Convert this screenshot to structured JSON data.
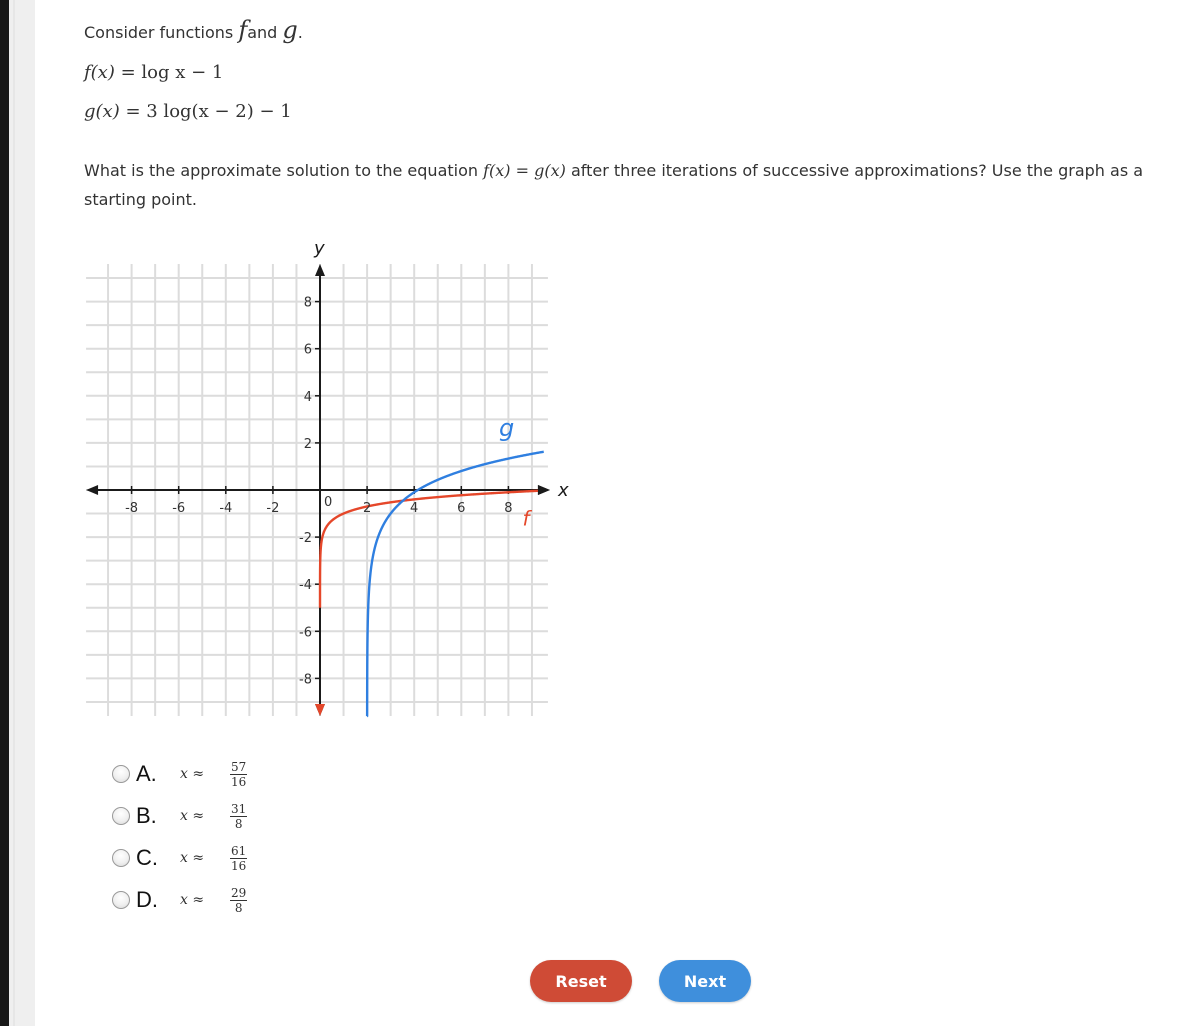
{
  "intro": {
    "prefix": "Consider functions ",
    "f": "f",
    "and": "and ",
    "g": "g",
    "suffix": "."
  },
  "equations": {
    "f": {
      "lhs": "f(x)",
      "rhs": "= log x − 1"
    },
    "g": {
      "lhs": "g(x)",
      "rhs": "= 3 log(x − 2) − 1"
    }
  },
  "question": {
    "before": "What is the approximate solution to the equation ",
    "math": "f(x) = g(x)",
    "after": " after three iterations of successive approximations? Use the graph as a starting point."
  },
  "chart_data": {
    "type": "line",
    "title": "",
    "xlabel": "x",
    "ylabel": "y",
    "xlim": [
      -9,
      9
    ],
    "ylim": [
      -9,
      9
    ],
    "grid": true,
    "origin_label": "0",
    "x_ticks": [
      -8,
      -6,
      -4,
      -2,
      2,
      4,
      6,
      8
    ],
    "x_tick_labels": [
      "-8",
      "-6",
      "-4",
      "-2",
      "2",
      "4",
      "6",
      "8"
    ],
    "y_ticks": [
      8,
      6,
      4,
      2,
      -2,
      -4,
      -6,
      -8
    ],
    "y_tick_labels": [
      "8",
      "6",
      "4",
      "2",
      "-2",
      "-4",
      "-6",
      "-8"
    ],
    "series": [
      {
        "name": "f",
        "label": "f",
        "color": "#e5472a",
        "expression": "log10(x) - 1",
        "domain": [
          0.0001,
          9.3
        ],
        "sample_points": [
          [
            0.3,
            -1.52
          ],
          [
            1,
            -1
          ],
          [
            2,
            -0.7
          ],
          [
            4,
            -0.4
          ],
          [
            6,
            -0.22
          ],
          [
            8,
            -0.1
          ],
          [
            9.3,
            -0.03
          ]
        ]
      },
      {
        "name": "g",
        "label": "g",
        "color": "#2f7fe0",
        "expression": "3*log10(x - 2) - 1",
        "domain": [
          2.0005,
          9.5
        ],
        "sample_points": [
          [
            2.5,
            -1.9
          ],
          [
            3,
            -1
          ],
          [
            4,
            -0.1
          ],
          [
            6,
            0.81
          ],
          [
            8,
            1.33
          ],
          [
            9.5,
            1.63
          ]
        ]
      }
    ]
  },
  "choices": [
    {
      "letter": "A.",
      "var": "x",
      "approx": "≈",
      "num": "57",
      "den": "16"
    },
    {
      "letter": "B.",
      "var": "x",
      "approx": "≈",
      "num": "31",
      "den": "8"
    },
    {
      "letter": "C.",
      "var": "x",
      "approx": "≈",
      "num": "61",
      "den": "16"
    },
    {
      "letter": "D.",
      "var": "x",
      "approx": "≈",
      "num": "29",
      "den": "8"
    }
  ],
  "buttons": {
    "reset": {
      "label": "Reset",
      "color": "#cf4b36"
    },
    "next": {
      "label": "Next",
      "color": "#3f8fdc"
    }
  }
}
